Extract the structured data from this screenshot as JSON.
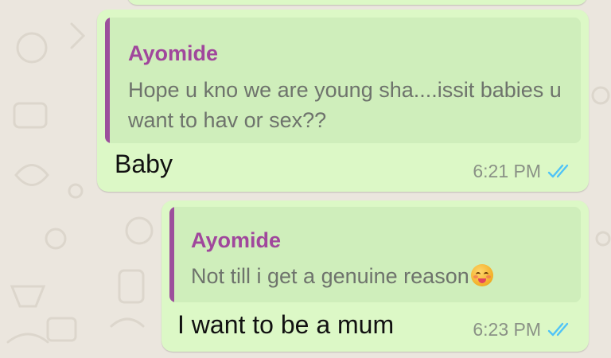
{
  "colors": {
    "background": "#ebe6de",
    "outgoing_bubble": "#dcf8c6",
    "quote_background": "#cfeebb",
    "quote_accent": "#9c4f9c",
    "quote_author": "#a0479c",
    "read_ticks": "#4fc3f7"
  },
  "messages": [
    {
      "quote": {
        "author": "Ayomide",
        "text": "Hope u kno we are young sha....issit babies u want to hav or sex??"
      },
      "text": "Baby",
      "time": "6:21 PM",
      "status_icon": "double-check-read-icon"
    },
    {
      "quote": {
        "author": "Ayomide",
        "text": "Not till i get a genuine reason",
        "emoji": "smiling-face-with-tongue-emoji"
      },
      "text": "I want to be a mum",
      "time": "6:23 PM",
      "status_icon": "double-check-read-icon"
    }
  ]
}
